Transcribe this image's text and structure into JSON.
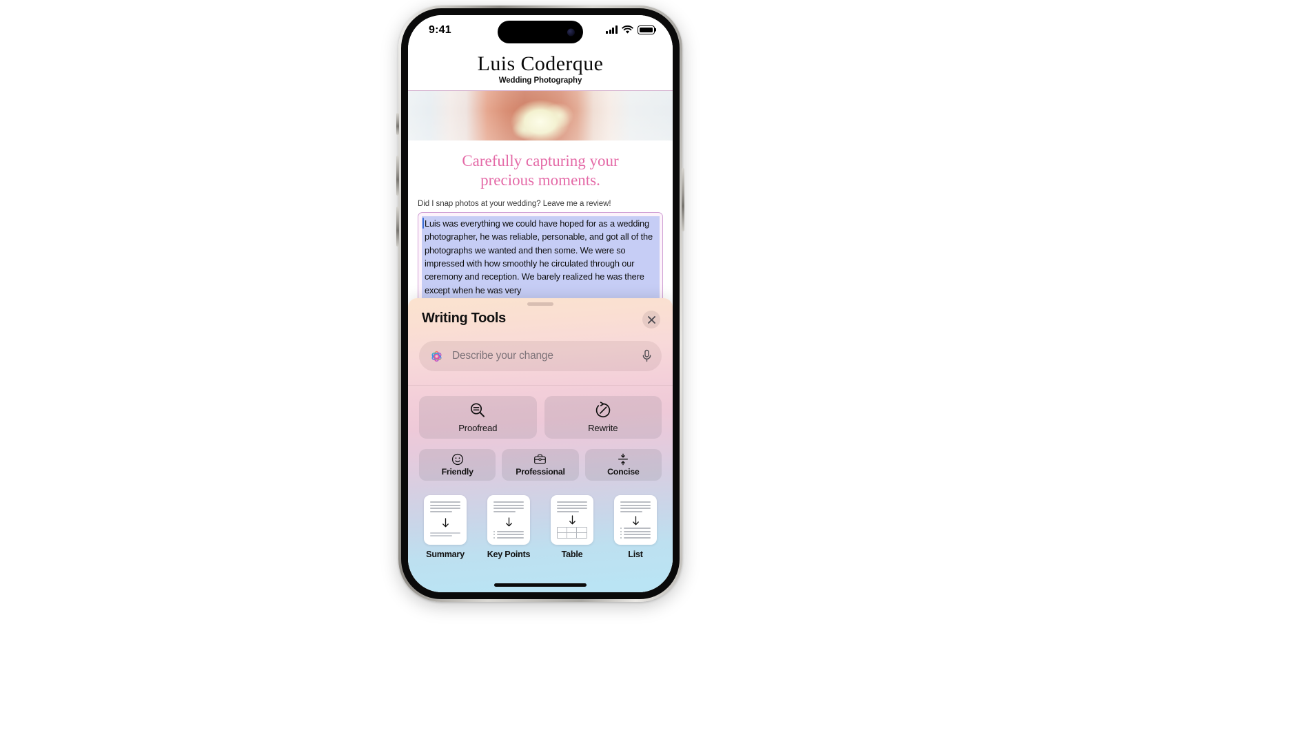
{
  "status_bar": {
    "time": "9:41",
    "signal_icon": "cellular-signal-icon",
    "wifi_icon": "wifi-icon",
    "battery_icon": "battery-icon"
  },
  "site": {
    "title": "Luis Coderque",
    "subtitle": "Wedding Photography",
    "hero_image_alt": "bride-holding-bouquet-photo",
    "tagline_line1": "Carefully capturing your",
    "tagline_line2": "precious moments.",
    "review_prompt": "Did I snap photos at your wedding? Leave me a review!",
    "review_text": "Luis was everything we could have hoped for as a wedding photographer, he was reliable, personable, and got all of the photographs we wanted and then some. We were so impressed with how smoothly he circulated through our ceremony and reception. We barely realized he was there except when he was very",
    "accent_color": "#e46aa7",
    "border_color": "#cf9fd4",
    "selection_color": "#c6cdf5"
  },
  "writing_tools": {
    "title": "Writing Tools",
    "close_label": "Close",
    "close_icon": "close-icon",
    "grabber": "sheet-grabber",
    "describe": {
      "placeholder": "Describe your change",
      "value": "",
      "leading_icon": "apple-intelligence-icon",
      "trailing_icon": "microphone-icon"
    },
    "primary_actions": [
      {
        "label": "Proofread",
        "icon": "magnifier-equals-icon"
      },
      {
        "label": "Rewrite",
        "icon": "rewrite-circle-arrow-icon"
      }
    ],
    "tones": [
      {
        "label": "Friendly",
        "icon": "smiley-face-icon"
      },
      {
        "label": "Professional",
        "icon": "briefcase-icon"
      },
      {
        "label": "Concise",
        "icon": "compress-arrows-icon"
      }
    ],
    "formats": [
      {
        "label": "Summary",
        "icon": "document-summary-icon"
      },
      {
        "label": "Key Points",
        "icon": "document-key-points-icon"
      },
      {
        "label": "Table",
        "icon": "document-table-icon"
      },
      {
        "label": "List",
        "icon": "document-list-icon"
      }
    ],
    "gradient_top": "#fbe3cf",
    "gradient_mid": "#eec9d8",
    "gradient_bottom": "#b9e5f5"
  },
  "device": {
    "home_indicator": "home-indicator",
    "buttons": [
      "action-button",
      "volume-up-button",
      "volume-down-button",
      "power-button"
    ]
  }
}
